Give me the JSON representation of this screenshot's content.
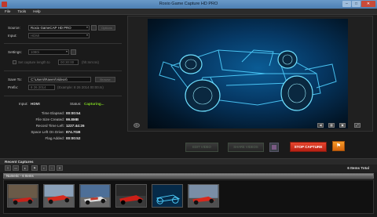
{
  "window": {
    "title": "Roxio Game Capture HD PRO",
    "controls": {
      "minimize": "–",
      "maximize": "□",
      "close": "✕"
    }
  },
  "menu": [
    "File",
    "Tools",
    "Help"
  ],
  "settings": {
    "source_label": "Source:",
    "source_value": "Roxio GameCAP HD PRO",
    "source_button": "Options",
    "input_label": "Input:",
    "input_value": "HDMI",
    "settings_label": "Settings:",
    "settings_value": "1080i",
    "capture_length_label": "Set capture length to",
    "capture_length_value": "00:30:00",
    "capture_length_unit": "(hh:mm:ss)",
    "save_to_label": "Save To:",
    "save_to_value": "C:\\Users\\Raven\\Videos\\",
    "save_to_button": "Browse",
    "prefix_label": "Prefix:",
    "prefix_value": "8 26 2014",
    "prefix_example": "(Example: 8 26 2014 00:00.ts)"
  },
  "status": {
    "input_label": "Input:",
    "input_value": "HDMI",
    "status_label": "Status:",
    "status_value": "Capturing..."
  },
  "stats": [
    {
      "label": "Time Elapsed:",
      "value": "00:00:54"
    },
    {
      "label": "File Size Created:",
      "value": "99.8MB"
    },
    {
      "label": "Record Time Left:",
      "value": "1227:44:26"
    },
    {
      "label": "Space Left On Drive:",
      "value": "874.7GB"
    },
    {
      "label": "Flag Added:",
      "value": "00:00:52"
    }
  ],
  "buttons": {
    "edit": "EDIT VIDEO",
    "share": "SHARE VIDEOS",
    "stop": "STOP CAPTURE"
  },
  "icons": {
    "preview_info": "info-icon",
    "preview_volume": "volume-icon",
    "preview_layout": "layout-icon",
    "preview_fullscreen": "fullscreen-icon",
    "save": "save-icon",
    "flag": "flag-icon",
    "toolbar": [
      "list-view-icon",
      "folder-icon",
      "play-icon",
      "flag-icon",
      "picture-icon",
      "frame-icon",
      "delete-icon"
    ]
  },
  "recent": {
    "title": "Recent Captures",
    "total": "6 Items Total",
    "group_label": "Numeric - 6 Items",
    "thumb_count": 6
  },
  "colors": {
    "status_green": "#7ed321",
    "stop_red": "#d8321f",
    "flag_orange": "#f08a1c",
    "preview_blue": "#0b5c95"
  }
}
